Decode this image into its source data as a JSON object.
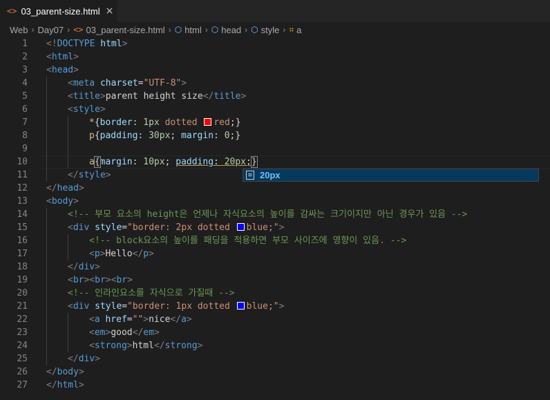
{
  "tab": {
    "icon": "<>",
    "label": "03_parent-size.html",
    "close": "×"
  },
  "breadcrumb": [
    {
      "label": "Web",
      "icon": "",
      "icon_name": ""
    },
    {
      "label": "Day07",
      "icon": "",
      "icon_name": ""
    },
    {
      "label": "03_parent-size.html",
      "icon": "<>",
      "icon_name": "html-file-icon"
    },
    {
      "label": "html",
      "icon": "⬡",
      "icon_name": "element-icon"
    },
    {
      "label": "head",
      "icon": "⬡",
      "icon_name": "element-icon"
    },
    {
      "label": "style",
      "icon": "⬡",
      "icon_name": "element-icon"
    },
    {
      "label": "a",
      "icon": "⌗",
      "icon_name": "selector-icon"
    }
  ],
  "colors": {
    "tag": "#569cd6",
    "attr": "#9cdcfe",
    "string": "#ce9178",
    "comment": "#6a9955",
    "selector": "#d7ba7d",
    "number": "#b5cea8",
    "swatch_red": "#ff0000",
    "swatch_blue": "#0000ff"
  },
  "editor": {
    "current_line": 10,
    "lines": [
      {
        "n": "1",
        "indent": 0,
        "tokens": [
          [
            "t",
            "<!"
          ],
          [
            "tn",
            "DOCTYPE"
          ],
          [
            "txt",
            " "
          ],
          [
            "an",
            "html"
          ],
          [
            "t",
            ">"
          ]
        ]
      },
      {
        "n": "2",
        "indent": 0,
        "tokens": [
          [
            "t",
            "<"
          ],
          [
            "tn",
            "html"
          ],
          [
            "t",
            ">"
          ]
        ]
      },
      {
        "n": "3",
        "indent": 0,
        "tokens": [
          [
            "t",
            "<"
          ],
          [
            "tn",
            "head"
          ],
          [
            "t",
            ">"
          ]
        ]
      },
      {
        "n": "4",
        "indent": 1,
        "tokens": [
          [
            "t",
            "<"
          ],
          [
            "tn",
            "meta"
          ],
          [
            "txt",
            " "
          ],
          [
            "an",
            "charset"
          ],
          [
            "txt",
            "="
          ],
          [
            "av",
            "\"UTF-8\""
          ],
          [
            "t",
            ">"
          ]
        ]
      },
      {
        "n": "5",
        "indent": 1,
        "tokens": [
          [
            "t",
            "<"
          ],
          [
            "tn",
            "title"
          ],
          [
            "t",
            ">"
          ],
          [
            "txt",
            "parent height size"
          ],
          [
            "t",
            "</"
          ],
          [
            "tn",
            "title"
          ],
          [
            "t",
            ">"
          ]
        ]
      },
      {
        "n": "6",
        "indent": 1,
        "tokens": [
          [
            "t",
            "<"
          ],
          [
            "tn",
            "style"
          ],
          [
            "t",
            ">"
          ]
        ]
      },
      {
        "n": "7",
        "indent": 2,
        "tokens": [
          [
            "sel",
            "*"
          ],
          [
            "txt",
            "{"
          ],
          [
            "pn",
            "border"
          ],
          [
            "txt",
            ": "
          ],
          [
            "nv",
            "1px"
          ],
          [
            "txt",
            " "
          ],
          [
            "kv",
            "dotted"
          ],
          [
            "txt",
            " "
          ],
          [
            "swatch",
            "red"
          ],
          [
            "kv",
            "red"
          ],
          [
            "txt",
            ";}"
          ]
        ]
      },
      {
        "n": "8",
        "indent": 2,
        "tokens": [
          [
            "sel",
            "p"
          ],
          [
            "txt",
            "{"
          ],
          [
            "pn",
            "padding"
          ],
          [
            "txt",
            ": "
          ],
          [
            "nv",
            "30px"
          ],
          [
            "txt",
            "; "
          ],
          [
            "pn",
            "margin"
          ],
          [
            "txt",
            ": "
          ],
          [
            "nv",
            "0"
          ],
          [
            "txt",
            ";}"
          ]
        ]
      },
      {
        "n": "9",
        "indent": 2,
        "tokens": []
      },
      {
        "n": "10",
        "indent": 2,
        "tokens": [
          [
            "sel",
            "a"
          ],
          [
            "brace",
            "{"
          ],
          [
            "pn",
            "margin"
          ],
          [
            "txt",
            ": "
          ],
          [
            "nv",
            "10px"
          ],
          [
            "txt",
            "; "
          ],
          [
            "und_pn",
            "padding"
          ],
          [
            "und_txt",
            ": "
          ],
          [
            "und_nv",
            "20px"
          ],
          [
            "und_txt",
            ";"
          ],
          [
            "brace",
            "}"
          ]
        ]
      },
      {
        "n": "11",
        "indent": 1,
        "tokens": [
          [
            "t",
            "</"
          ],
          [
            "tn",
            "style"
          ],
          [
            "t",
            ">"
          ]
        ]
      },
      {
        "n": "12",
        "indent": 0,
        "tokens": [
          [
            "t",
            "</"
          ],
          [
            "tn",
            "head"
          ],
          [
            "t",
            ">"
          ]
        ]
      },
      {
        "n": "13",
        "indent": 0,
        "tokens": [
          [
            "t",
            "<"
          ],
          [
            "tn",
            "body"
          ],
          [
            "t",
            ">"
          ]
        ]
      },
      {
        "n": "14",
        "indent": 1,
        "tokens": [
          [
            "cm",
            "<!-- 부모 요소의 height은 언제나 자식요소의 높이를 감싸는 크기이지만 아닌 경우가 있음 -->"
          ]
        ]
      },
      {
        "n": "15",
        "indent": 1,
        "tokens": [
          [
            "t",
            "<"
          ],
          [
            "tn",
            "div"
          ],
          [
            "txt",
            " "
          ],
          [
            "an",
            "style"
          ],
          [
            "txt",
            "="
          ],
          [
            "av",
            "\"border: 2px dotted "
          ],
          [
            "swatch",
            "blue"
          ],
          [
            "av",
            "blue;\""
          ],
          [
            "t",
            ">"
          ]
        ]
      },
      {
        "n": "16",
        "indent": 2,
        "tokens": [
          [
            "cm",
            "<!-- block요소의 높이를 패딩을 적용하면 부모 사이즈에 영향이 있음. -->"
          ]
        ]
      },
      {
        "n": "17",
        "indent": 2,
        "tokens": [
          [
            "t",
            "<"
          ],
          [
            "tn",
            "p"
          ],
          [
            "t",
            ">"
          ],
          [
            "txt",
            "Hello"
          ],
          [
            "t",
            "</"
          ],
          [
            "tn",
            "p"
          ],
          [
            "t",
            ">"
          ]
        ]
      },
      {
        "n": "18",
        "indent": 1,
        "tokens": [
          [
            "t",
            "</"
          ],
          [
            "tn",
            "div"
          ],
          [
            "t",
            ">"
          ]
        ]
      },
      {
        "n": "19",
        "indent": 1,
        "tokens": [
          [
            "t",
            "<"
          ],
          [
            "tn",
            "br"
          ],
          [
            "t",
            "><"
          ],
          [
            "tn",
            "br"
          ],
          [
            "t",
            "><"
          ],
          [
            "tn",
            "br"
          ],
          [
            "t",
            ">"
          ]
        ]
      },
      {
        "n": "20",
        "indent": 1,
        "tokens": [
          [
            "cm",
            "<!-- 인라인요소를 자식으로 가질때 -->"
          ]
        ]
      },
      {
        "n": "21",
        "indent": 1,
        "tokens": [
          [
            "t",
            "<"
          ],
          [
            "tn",
            "div"
          ],
          [
            "txt",
            " "
          ],
          [
            "an",
            "style"
          ],
          [
            "txt",
            "="
          ],
          [
            "av",
            "\"border: 1px dotted "
          ],
          [
            "swatch",
            "blue"
          ],
          [
            "av",
            "blue;\""
          ],
          [
            "t",
            ">"
          ]
        ]
      },
      {
        "n": "22",
        "indent": 2,
        "tokens": [
          [
            "t",
            "<"
          ],
          [
            "tn",
            "a"
          ],
          [
            "txt",
            " "
          ],
          [
            "an",
            "href"
          ],
          [
            "txt",
            "="
          ],
          [
            "av",
            "\"\""
          ],
          [
            "t",
            ">"
          ],
          [
            "txt",
            "nice"
          ],
          [
            "t",
            "</"
          ],
          [
            "tn",
            "a"
          ],
          [
            "t",
            ">"
          ]
        ]
      },
      {
        "n": "23",
        "indent": 2,
        "tokens": [
          [
            "t",
            "<"
          ],
          [
            "tn",
            "em"
          ],
          [
            "t",
            ">"
          ],
          [
            "txt",
            "good"
          ],
          [
            "t",
            "</"
          ],
          [
            "tn",
            "em"
          ],
          [
            "t",
            ">"
          ]
        ]
      },
      {
        "n": "24",
        "indent": 2,
        "tokens": [
          [
            "t",
            "<"
          ],
          [
            "tn",
            "strong"
          ],
          [
            "t",
            ">"
          ],
          [
            "txt",
            "html"
          ],
          [
            "t",
            "</"
          ],
          [
            "tn",
            "strong"
          ],
          [
            "t",
            ">"
          ]
        ]
      },
      {
        "n": "25",
        "indent": 1,
        "tokens": [
          [
            "t",
            "</"
          ],
          [
            "tn",
            "div"
          ],
          [
            "t",
            ">"
          ]
        ]
      },
      {
        "n": "26",
        "indent": 0,
        "tokens": [
          [
            "t",
            "</"
          ],
          [
            "tn",
            "body"
          ],
          [
            "t",
            ">"
          ]
        ]
      },
      {
        "n": "27",
        "indent": 0,
        "tokens": [
          [
            "t",
            "</"
          ],
          [
            "tn",
            "html"
          ],
          [
            "t",
            ">"
          ]
        ]
      }
    ]
  },
  "suggestion": {
    "icon": "snippet-icon",
    "icon_glyph": "≡",
    "label": "20px"
  }
}
